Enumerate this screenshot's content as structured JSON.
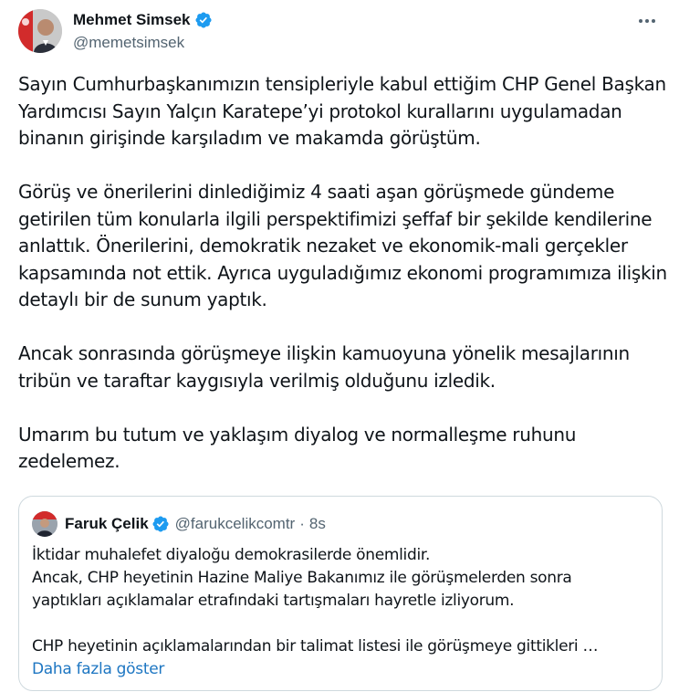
{
  "author": {
    "name": "Mehmet Simsek",
    "handle": "@memetsimsek"
  },
  "more_icon": "more-horizontal-icon",
  "body": {
    "paragraphs": [
      [
        "Sayın Cumhurbaşkanımızın tensipleriyle kabul ettiğim CHP Genel Başkan",
        "Yardımcısı Sayın Yalçın Karatepe’yi protokol kurallarını uygulamadan",
        "binanın girişinde karşıladım ve makamda görüştüm."
      ],
      [
        "Görüş ve önerilerini dinlediğimiz 4 saati aşan görüşmede gündeme",
        "getirilen tüm konularla ilgili perspektifimizi şeffaf bir şekilde kendilerine",
        "anlattık. Önerilerini, demokratik nezaket ve ekonomik-mali gerçekler",
        "kapsamında not ettik. Ayrıca uyguladığımız ekonomi programımıza ilişkin",
        "detaylı bir de sunum yaptık."
      ],
      [
        "Ancak sonrasında görüşmeye ilişkin kamuoyuna yönelik mesajlarının",
        "tribün ve taraftar kaygısıyla verilmiş olduğunu izledik."
      ],
      [
        "Umarım bu tutum ve yaklaşım diyalog ve normalleşme ruhunu",
        "zedelemez."
      ]
    ]
  },
  "quote": {
    "name": "Faruk Çelik",
    "handle": "@farukcelikcomtr",
    "separator": "·",
    "time": "8s",
    "paragraphs": [
      [
        "İktidar muhalefet diyaloğu demokrasilerde önemlidir.",
        "Ancak, CHP heyetinin Hazine Maliye Bakanımız ile görüşmelerden sonra",
        "yaptıkları açıklamalar etrafındaki tartışmaları hayretle izliyorum."
      ],
      [
        "CHP heyetinin açıklamalarından bir talimat listesi ile görüşmeye gittikleri …"
      ]
    ],
    "show_more": "Daha fazla göster"
  },
  "colors": {
    "text": "#0f1419",
    "secondary": "#536471",
    "link": "#1d76c2",
    "verified": "#1d9bf0",
    "border": "#cfd9de"
  }
}
